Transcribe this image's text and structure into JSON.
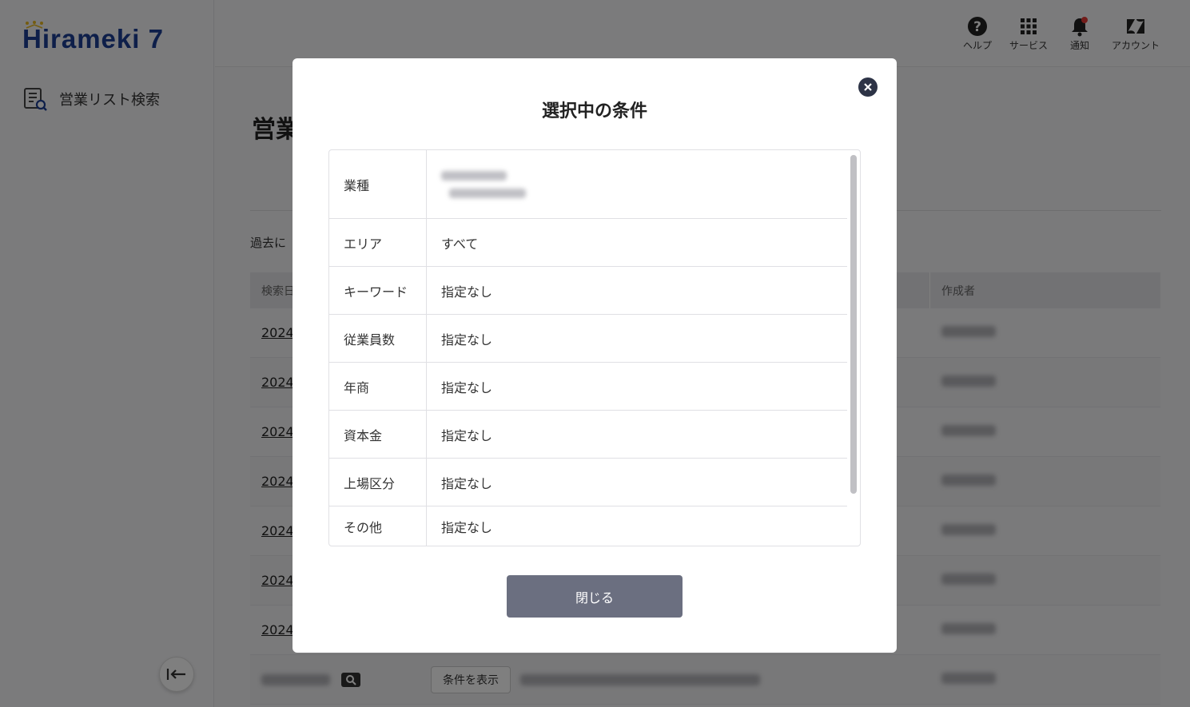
{
  "app": {
    "logo_text": "Hirameki 7"
  },
  "sidebar": {
    "items": [
      {
        "label": "営業リスト検索"
      }
    ]
  },
  "topbar": {
    "icons": [
      {
        "label": "ヘルプ",
        "icon": "help-icon"
      },
      {
        "label": "サービス",
        "icon": "grid-icon"
      },
      {
        "label": "通知",
        "icon": "bell-icon"
      },
      {
        "label": "アカウント",
        "icon": "zendesk-icon"
      }
    ]
  },
  "main": {
    "page_title": "営業",
    "history_text": "過去に",
    "table": {
      "headers": [
        "検索日",
        "",
        "作成者"
      ],
      "rows": [
        {
          "date": "2024/"
        },
        {
          "date": "2024/"
        },
        {
          "date": "2024/"
        },
        {
          "date": "2024/"
        },
        {
          "date": "2024/"
        },
        {
          "date": "2024/"
        },
        {
          "date": "2024/"
        }
      ],
      "last_row_button": "条件を表示"
    }
  },
  "modal": {
    "title": "選択中の条件",
    "conditions": [
      {
        "key": "業種",
        "value": ""
      },
      {
        "key": "エリア",
        "value": "すべて"
      },
      {
        "key": "キーワード",
        "value": "指定なし"
      },
      {
        "key": "従業員数",
        "value": "指定なし"
      },
      {
        "key": "年商",
        "value": "指定なし"
      },
      {
        "key": "資本金",
        "value": "指定なし"
      },
      {
        "key": "上場区分",
        "value": "指定なし"
      },
      {
        "key": "その他",
        "value": "指定なし"
      }
    ],
    "close_label": "閉じる"
  },
  "colors": {
    "brand": "#1c3f94",
    "close_button": "#6b6f80",
    "notification_dot": "#e53935"
  }
}
